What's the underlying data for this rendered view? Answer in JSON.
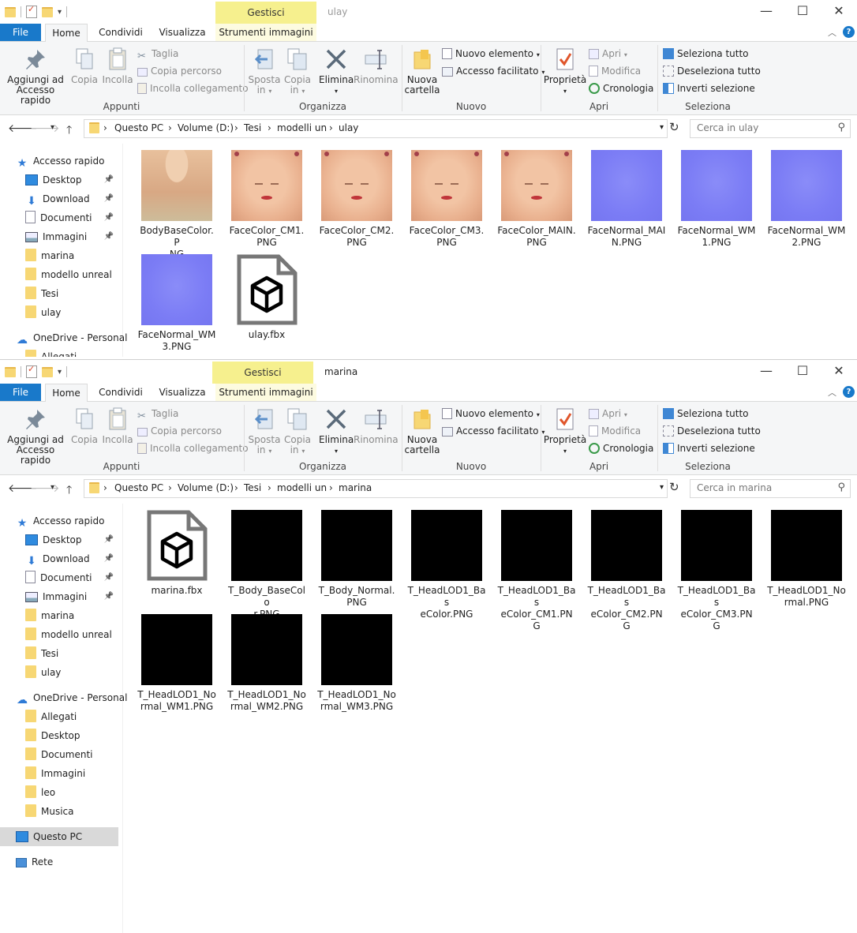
{
  "common": {
    "gestisci": "Gestisci",
    "tabs": [
      "File",
      "Home",
      "Condividi",
      "Visualizza",
      "Strumenti immagini"
    ],
    "ribbon": {
      "appunti": {
        "label": "Appunti",
        "pin": "Aggiungi ad",
        "pin2": "Accesso rapido",
        "copy": "Copia",
        "paste": "Incolla",
        "cut": "Taglia",
        "copy_path": "Copia percorso",
        "paste_link": "Incolla collegamento"
      },
      "organizza": {
        "label": "Organizza",
        "move": "Sposta",
        "move2": "in",
        "copyto": "Copia",
        "copyto2": "in",
        "delete": "Elimina",
        "rename": "Rinomina"
      },
      "nuovo": {
        "label": "Nuovo",
        "new_folder": "Nuova",
        "new_folder2": "cartella",
        "new_item": "Nuovo elemento",
        "easy_access": "Accesso facilitato"
      },
      "apri": {
        "label": "Apri",
        "properties": "Proprietà",
        "open": "Apri",
        "edit": "Modifica",
        "history": "Cronologia"
      },
      "seleziona": {
        "label": "Seleziona",
        "all": "Seleziona tutto",
        "none": "Deseleziona tutto",
        "invert": "Inverti selezione"
      }
    },
    "crumbs": [
      "Questo PC",
      "Volume (D:)",
      "Tesi",
      "modelli un"
    ]
  },
  "win1": {
    "title": "ulay",
    "crumb_last": "ulay",
    "search_placeholder": "Cerca in ulay",
    "nav": [
      {
        "label": "Accesso rapido",
        "icon": "star-icon"
      },
      {
        "label": "Desktop",
        "icon": "desktop-icon",
        "pinned": true
      },
      {
        "label": "Download",
        "icon": "download-icon",
        "pinned": true
      },
      {
        "label": "Documenti",
        "icon": "documents-icon",
        "pinned": true
      },
      {
        "label": "Immagini",
        "icon": "pictures-icon",
        "pinned": true
      },
      {
        "label": "marina",
        "icon": "folder-icon"
      },
      {
        "label": "modello unreal",
        "icon": "folder-icon"
      },
      {
        "label": "Tesi",
        "icon": "folder-icon"
      },
      {
        "label": "ulay",
        "icon": "folder-icon"
      },
      {
        "label": "OneDrive - Personal",
        "icon": "cloud-icon"
      },
      {
        "label": "Allegati",
        "icon": "folder-icon"
      }
    ],
    "files": [
      {
        "name": "BodyBaseColor.PNG",
        "line1": "BodyBaseColor.P",
        "line2": "NG",
        "kind": "body"
      },
      {
        "name": "FaceColor_CM1.PNG",
        "line1": "FaceColor_CM1.",
        "line2": "PNG",
        "kind": "face"
      },
      {
        "name": "FaceColor_CM2.PNG",
        "line1": "FaceColor_CM2.",
        "line2": "PNG",
        "kind": "face"
      },
      {
        "name": "FaceColor_CM3.PNG",
        "line1": "FaceColor_CM3.",
        "line2": "PNG",
        "kind": "face"
      },
      {
        "name": "FaceColor_MAIN.PNG",
        "line1": "FaceColor_MAIN.",
        "line2": "PNG",
        "kind": "face"
      },
      {
        "name": "FaceNormal_MAIN.PNG",
        "line1": "FaceNormal_MAI",
        "line2": "N.PNG",
        "kind": "normal"
      },
      {
        "name": "FaceNormal_WM1.PNG",
        "line1": "FaceNormal_WM",
        "line2": "1.PNG",
        "kind": "normal"
      },
      {
        "name": "FaceNormal_WM2.PNG",
        "line1": "FaceNormal_WM",
        "line2": "2.PNG",
        "kind": "normal"
      },
      {
        "name": "FaceNormal_WM3.PNG",
        "line1": "FaceNormal_WM",
        "line2": "3.PNG",
        "kind": "normal"
      },
      {
        "name": "ulay.fbx",
        "line1": "ulay.fbx",
        "line2": "",
        "kind": "fbx"
      }
    ]
  },
  "win2": {
    "title": "marina",
    "crumb_last": "marina",
    "search_placeholder": "Cerca in marina",
    "nav": [
      {
        "label": "Accesso rapido",
        "icon": "star-icon"
      },
      {
        "label": "Desktop",
        "icon": "desktop-icon",
        "pinned": true
      },
      {
        "label": "Download",
        "icon": "download-icon",
        "pinned": true
      },
      {
        "label": "Documenti",
        "icon": "documents-icon",
        "pinned": true
      },
      {
        "label": "Immagini",
        "icon": "pictures-icon",
        "pinned": true
      },
      {
        "label": "marina",
        "icon": "folder-icon"
      },
      {
        "label": "modello unreal",
        "icon": "folder-icon"
      },
      {
        "label": "Tesi",
        "icon": "folder-icon"
      },
      {
        "label": "ulay",
        "icon": "folder-icon"
      },
      {
        "label": "OneDrive - Personal",
        "icon": "cloud-icon"
      },
      {
        "label": "Allegati",
        "icon": "folder-icon"
      },
      {
        "label": "Desktop",
        "icon": "folder-icon"
      },
      {
        "label": "Documenti",
        "icon": "folder-icon"
      },
      {
        "label": "Immagini",
        "icon": "folder-icon"
      },
      {
        "label": "leo",
        "icon": "folder-icon"
      },
      {
        "label": "Musica",
        "icon": "folder-icon"
      },
      {
        "label": "Questo PC",
        "icon": "pc-icon",
        "selected": true
      },
      {
        "label": "Rete",
        "icon": "network-icon"
      }
    ],
    "files": [
      {
        "name": "marina.fbx",
        "line1": "marina.fbx",
        "line2": "",
        "kind": "fbx"
      },
      {
        "name": "T_Body_BaseColor.PNG",
        "line1": "T_Body_BaseColo",
        "line2": "r.PNG",
        "kind": "black"
      },
      {
        "name": "T_Body_Normal.PNG",
        "line1": "T_Body_Normal.",
        "line2": "PNG",
        "kind": "black"
      },
      {
        "name": "T_HeadLOD1_BaseColor.PNG",
        "line1": "T_HeadLOD1_Bas",
        "line2": "eColor.PNG",
        "kind": "black"
      },
      {
        "name": "T_HeadLOD1_BaseColor_CM1.PNG",
        "line1": "T_HeadLOD1_Bas",
        "line2": "eColor_CM1.PNG",
        "kind": "black"
      },
      {
        "name": "T_HeadLOD1_BaseColor_CM2.PNG",
        "line1": "T_HeadLOD1_Bas",
        "line2": "eColor_CM2.PNG",
        "kind": "black"
      },
      {
        "name": "T_HeadLOD1_BaseColor_CM3.PNG",
        "line1": "T_HeadLOD1_Bas",
        "line2": "eColor_CM3.PNG",
        "kind": "black"
      },
      {
        "name": "T_HeadLOD1_Normal.PNG",
        "line1": "T_HeadLOD1_No",
        "line2": "rmal.PNG",
        "kind": "black"
      },
      {
        "name": "T_HeadLOD1_Normal_WM1.PNG",
        "line1": "T_HeadLOD1_No",
        "line2": "rmal_WM1.PNG",
        "kind": "black"
      },
      {
        "name": "T_HeadLOD1_Normal_WM2.PNG",
        "line1": "T_HeadLOD1_No",
        "line2": "rmal_WM2.PNG",
        "kind": "black"
      },
      {
        "name": "T_HeadLOD1_Normal_WM3.PNG",
        "line1": "T_HeadLOD1_No",
        "line2": "rmal_WM3.PNG",
        "kind": "black"
      }
    ]
  },
  "colors": {
    "accent": "#1979ca",
    "gestisci_bg": "#f6f08e",
    "folder": "#f7d774",
    "normal_map": "#7b7cf5",
    "selected_nav": "#d9d9d9"
  }
}
